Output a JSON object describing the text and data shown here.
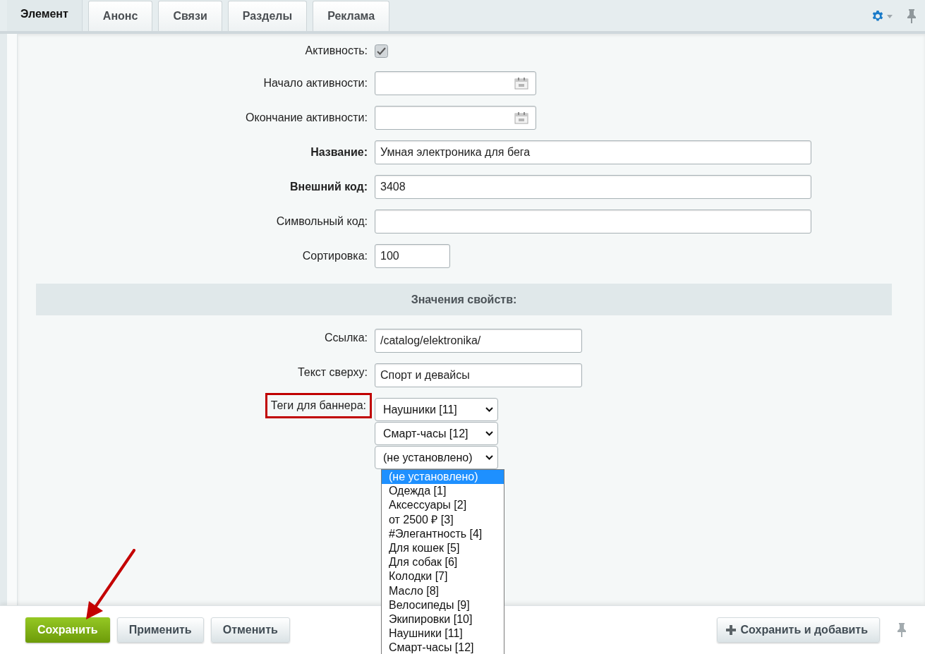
{
  "tabs": [
    {
      "label": "Элемент",
      "selected": true
    },
    {
      "label": "Анонс",
      "selected": false
    },
    {
      "label": "Связи",
      "selected": false
    },
    {
      "label": "Разделы",
      "selected": false
    },
    {
      "label": "Реклама",
      "selected": false
    }
  ],
  "fields": [
    {
      "kind": "checkbox",
      "label": "Активность:",
      "required": false,
      "checked": true
    },
    {
      "kind": "date",
      "label": "Начало активности:",
      "required": false
    },
    {
      "kind": "date",
      "label": "Окончание активности:",
      "required": false
    },
    {
      "kind": "text",
      "label": "Название:",
      "required": true,
      "value": "Умная электроника для бега"
    },
    {
      "kind": "text",
      "label": "Внешний код:",
      "required": true,
      "value": "3408"
    },
    {
      "kind": "text",
      "label": "Символьный код:",
      "required": false
    },
    {
      "kind": "short",
      "label": "Сортировка:",
      "required": false,
      "value": "100"
    }
  ],
  "section": {
    "title": "Значения свойств:"
  },
  "properties": [
    {
      "kind": "text",
      "label": "Ссылка:",
      "highlighted": false,
      "value": "/catalog/elektronika/"
    },
    {
      "kind": "text",
      "label": "Текст сверху:",
      "highlighted": false,
      "value": "Спорт и девайсы"
    },
    {
      "kind": "selects",
      "label": "Теги для баннера:",
      "highlighted": true,
      "selects": [
        {
          "value": "Наушники [11]"
        },
        {
          "value": "Смарт-часы [12]"
        },
        {
          "value": "(не установлено)"
        }
      ]
    }
  ],
  "dropdown": {
    "options": [
      {
        "label": "(не установлено)",
        "selected": true
      },
      {
        "label": "Одежда [1]",
        "selected": false
      },
      {
        "label": "Аксессуары [2]",
        "selected": false
      },
      {
        "label": "от 2500 ₽ [3]",
        "selected": false
      },
      {
        "label": "#Элегантность [4]",
        "selected": false
      },
      {
        "label": "Для кошек [5]",
        "selected": false
      },
      {
        "label": "Для собак [6]",
        "selected": false
      },
      {
        "label": "Колодки [7]",
        "selected": false
      },
      {
        "label": "Масло [8]",
        "selected": false
      },
      {
        "label": "Велосипеды [9]",
        "selected": false
      },
      {
        "label": "Экипировки [10]",
        "selected": false
      },
      {
        "label": "Наушники [11]",
        "selected": false
      },
      {
        "label": "Смарт-часы [12]",
        "selected": false
      }
    ]
  },
  "buttons": [
    {
      "label": "Сохранить",
      "kind": "primary"
    },
    {
      "label": "Применить",
      "kind": "secondary"
    },
    {
      "label": "Отменить",
      "kind": "secondary"
    }
  ],
  "right_button": {
    "label": "Сохранить и добавить"
  }
}
